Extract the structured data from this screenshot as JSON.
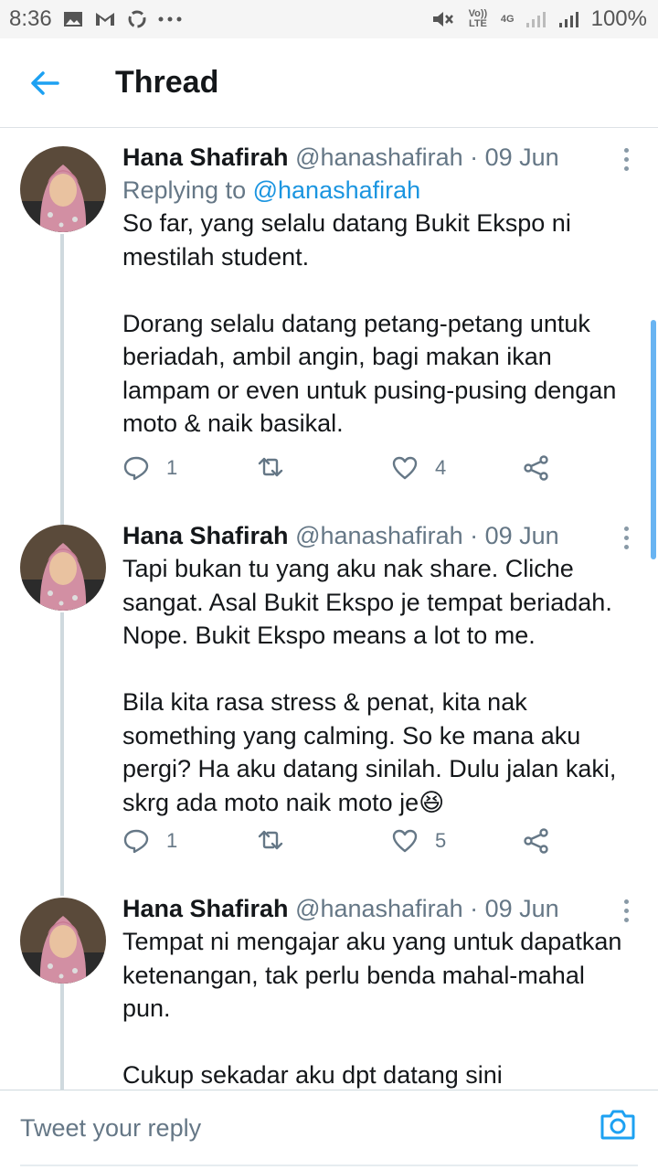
{
  "status_bar": {
    "time": "8:36",
    "icons_left": [
      "gallery-icon",
      "gmail-icon",
      "sync-icon",
      "more-dots-icon"
    ],
    "volte": "Vo)) LTE",
    "network": "4G",
    "battery": "100%"
  },
  "header": {
    "title": "Thread"
  },
  "tweets": [
    {
      "name": "Hana Shafirah",
      "handle": "@hanashafirah",
      "date": "· 09 Jun",
      "replying_label": "Replying to",
      "replying_handle": "@hanashafirah",
      "text": "So far, yang selalu datang Bukit Ekspo ni\nmestilah student.\n\nDorang selalu datang petang-petang untuk\nberiadah, ambil angin, bagi makan ikan\nlampam or even untuk pusing-pusing dengan\nmoto & naik basikal.",
      "replies": "1",
      "retweets": "",
      "likes": "4"
    },
    {
      "name": "Hana Shafirah",
      "handle": "@hanashafirah",
      "date": "· 09 Jun",
      "text": "Tapi bukan tu yang aku nak share. Cliche\nsangat. Asal Bukit Ekspo je tempat beriadah.\nNope. Bukit Ekspo means a lot to me.\n\nBila kita rasa stress & penat, kita nak\nsomething yang calming. So ke mana aku\npergi? Ha aku datang sinilah. Dulu jalan kaki,\nskrg ada moto naik moto je😆",
      "replies": "1",
      "retweets": "",
      "likes": "5"
    },
    {
      "name": "Hana Shafirah",
      "handle": "@hanashafirah",
      "date": "· 09 Jun",
      "text": "Tempat ni mengajar aku yang untuk dapatkan\nketenangan, tak perlu benda mahal-mahal\npun.\n\nCukup sekadar aku dpt datang sini"
    }
  ],
  "reply_bar": {
    "placeholder": "Tweet your reply"
  },
  "colors": {
    "accent": "#1da1f2",
    "link": "#1b95e0",
    "muted": "#657786"
  }
}
